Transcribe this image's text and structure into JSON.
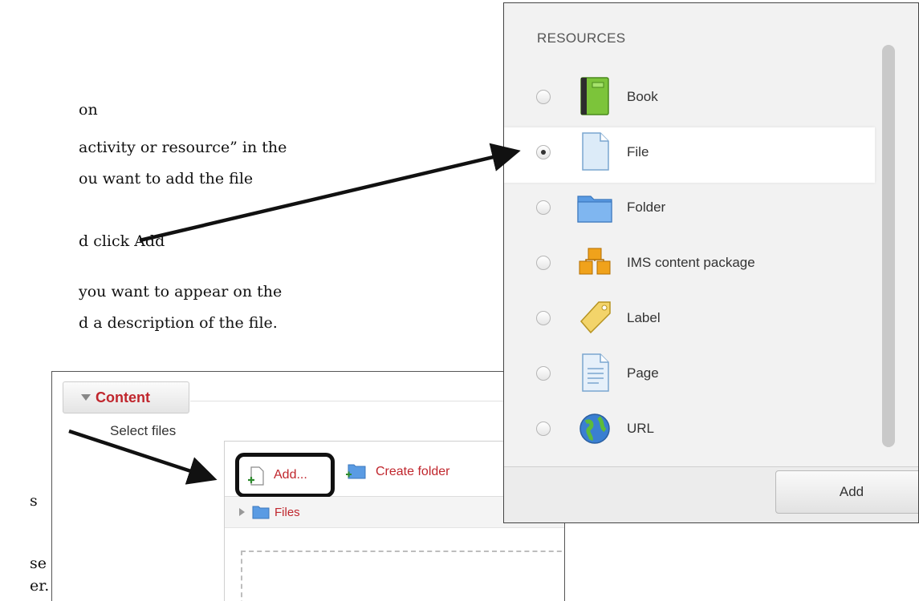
{
  "document": {
    "lines": [
      "on",
      "activity or resource” in the",
      "ou want to add the file",
      "d click Add",
      "you want to appear on the",
      "d a description of the file.",
      "s",
      "se",
      "er."
    ]
  },
  "resources_dialog": {
    "header": "RESOURCES",
    "items": [
      {
        "label": "Book",
        "icon": "book-icon",
        "checked": false
      },
      {
        "label": "File",
        "icon": "file-icon",
        "checked": true
      },
      {
        "label": "Folder",
        "icon": "folder-icon",
        "checked": false
      },
      {
        "label": "IMS content package",
        "icon": "package-icon",
        "checked": false
      },
      {
        "label": "Label",
        "icon": "label-tag-icon",
        "checked": false
      },
      {
        "label": "Page",
        "icon": "page-icon",
        "checked": false
      },
      {
        "label": "URL",
        "icon": "globe-icon",
        "checked": false
      }
    ],
    "add_button": "Add"
  },
  "content_section": {
    "toggle_label": "Content",
    "select_files_label": "Select files",
    "file_picker": {
      "add_label": "Add...",
      "create_folder_label": "Create folder",
      "path_label": "Files"
    }
  },
  "colors": {
    "link_red": "#c0262d",
    "panel_bg": "#f2f2f2"
  }
}
